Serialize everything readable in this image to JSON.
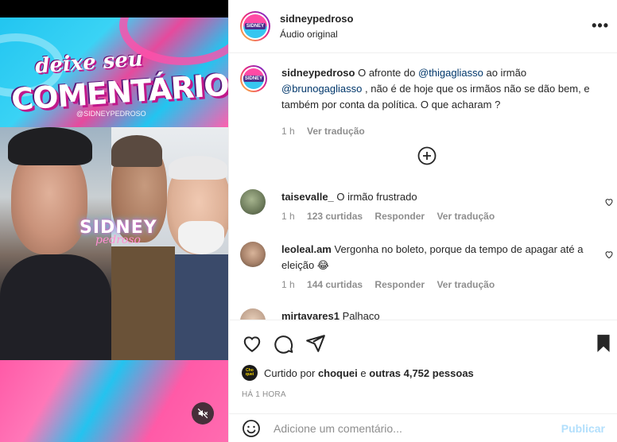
{
  "media": {
    "banner_line1": "deixe seu",
    "banner_line2": "COMENTÁRIO",
    "banner_handle": "@SIDNEYPEDROSO",
    "overlay_logo": "SIDNEY",
    "overlay_logo_sub": "pedroso"
  },
  "header": {
    "username": "sidneypedroso",
    "subtitle": "Áudio original",
    "avatar_text": "SIDNEY",
    "more": "•••"
  },
  "caption": {
    "username": "sidneypedroso",
    "text_before": "O afronte do",
    "mention1": "@thigagliasso",
    "text_mid": "ao irmão",
    "mention2": "@brunogagliasso",
    "text_after": ", não é de hoje que os irmãos não se dão bem, e também por conta da política. O que acharam ?",
    "time": "1 h",
    "translate": "Ver tradução"
  },
  "comments": [
    {
      "username": "taisevalle_",
      "text": "O irmão frustrado",
      "time": "1 h",
      "likes": "123 curtidas",
      "reply": "Responder",
      "translate": "Ver tradução"
    },
    {
      "username": "leoleal.am",
      "text": "Vergonha no boleto, porque da tempo de apagar até a eleição 😂",
      "time": "1 h",
      "likes": "144 curtidas",
      "reply": "Responder",
      "translate": "Ver tradução"
    },
    {
      "username": "mirtavares1",
      "text": "Palhaço"
    }
  ],
  "likes": {
    "prefix": "Curtido por",
    "user": "choquei",
    "conj": "e",
    "others": "outras 4,752 pessoas",
    "avatar_text": "Cho quei"
  },
  "time_ago": "HÁ 1 HORA",
  "add_comment": {
    "placeholder": "Adicione um comentário...",
    "publish": "Publicar"
  },
  "colors": {
    "mention": "#00376b",
    "muted": "#8e8e8e",
    "publish_disabled": "#b2dffc"
  }
}
